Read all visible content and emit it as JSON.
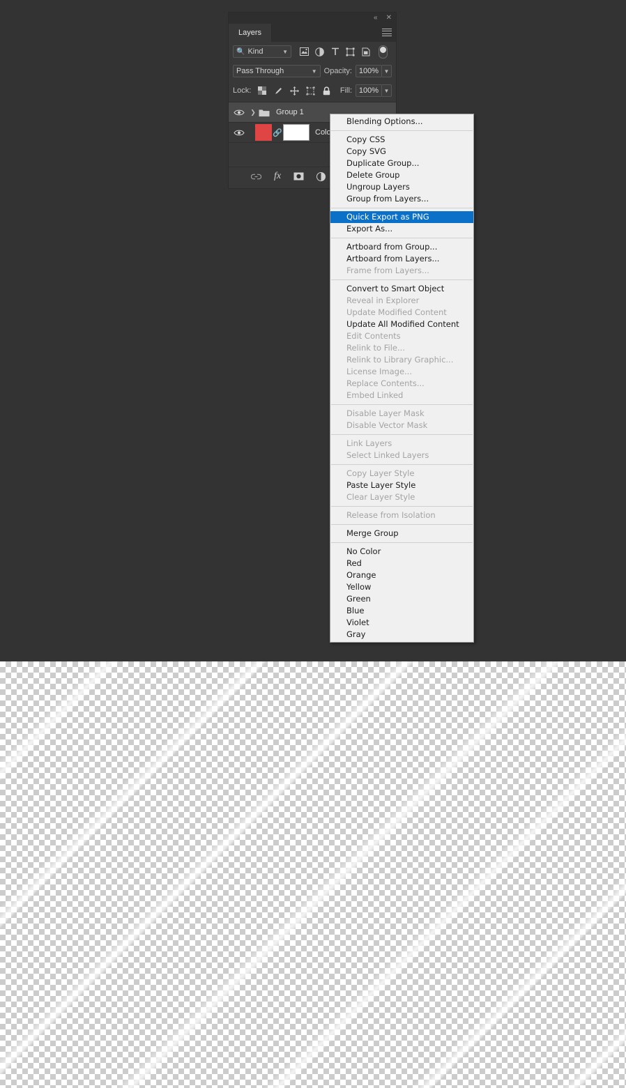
{
  "panel": {
    "title": "Layers",
    "titlebar": {
      "collapse_icon": "double-chevron-left",
      "close_icon": "close-x"
    },
    "filter": {
      "kind_label": "Kind",
      "search_icon": "magnifier-icon",
      "icons": [
        "pixel-layer-filter",
        "adjustment-layer-filter",
        "type-layer-filter",
        "shape-layer-filter",
        "smart-object-filter"
      ],
      "toggle_name": "filter-enable-toggle"
    },
    "blend": {
      "mode": "Pass Through",
      "opacity_label": "Opacity:",
      "opacity_value": "100%"
    },
    "lock": {
      "label": "Lock:",
      "fill_label": "Fill:",
      "fill_value": "100%",
      "icons": [
        "lock-transparent-pixels",
        "lock-image-pixels",
        "lock-position",
        "lock-artboard-nesting",
        "lock-all"
      ]
    },
    "layers": [
      {
        "name": "Group 1",
        "type": "group",
        "visible": true,
        "selected": true,
        "eye_icon": "eye-icon",
        "disclosure_icon": "chevron-right-icon",
        "folder_icon": "folder-icon"
      },
      {
        "name": "Colo",
        "type": "solid-color-fill",
        "visible": true,
        "selected": false,
        "eye_icon": "eye-icon",
        "swatch_color": "#e04545",
        "link_icon": "mask-link-icon",
        "mask_color": "#ffffff"
      }
    ],
    "footer_icons": [
      "link-layers-icon",
      "add-layer-style-fx-icon",
      "add-layer-mask-icon",
      "new-adjustment-layer-icon",
      "new-group-icon"
    ]
  },
  "context_menu": {
    "groups": [
      {
        "items": [
          {
            "label": "Blending Options...",
            "state": "enabled"
          }
        ]
      },
      {
        "items": [
          {
            "label": "Copy CSS",
            "state": "enabled"
          },
          {
            "label": "Copy SVG",
            "state": "enabled"
          },
          {
            "label": "Duplicate Group...",
            "state": "enabled"
          },
          {
            "label": "Delete Group",
            "state": "enabled"
          },
          {
            "label": "Ungroup Layers",
            "state": "enabled"
          },
          {
            "label": "Group from Layers...",
            "state": "enabled"
          }
        ]
      },
      {
        "items": [
          {
            "label": "Quick Export as PNG",
            "state": "selected"
          },
          {
            "label": "Export As...",
            "state": "enabled"
          }
        ]
      },
      {
        "items": [
          {
            "label": "Artboard from Group...",
            "state": "enabled"
          },
          {
            "label": "Artboard from Layers...",
            "state": "enabled"
          },
          {
            "label": "Frame from Layers...",
            "state": "disabled"
          }
        ]
      },
      {
        "items": [
          {
            "label": "Convert to Smart Object",
            "state": "enabled"
          },
          {
            "label": "Reveal in Explorer",
            "state": "disabled"
          },
          {
            "label": "Update Modified Content",
            "state": "disabled"
          },
          {
            "label": "Update All Modified Content",
            "state": "enabled"
          },
          {
            "label": "Edit Contents",
            "state": "disabled"
          },
          {
            "label": "Relink to File...",
            "state": "disabled"
          },
          {
            "label": "Relink to Library Graphic...",
            "state": "disabled"
          },
          {
            "label": "License Image...",
            "state": "disabled"
          },
          {
            "label": "Replace Contents...",
            "state": "disabled"
          },
          {
            "label": "Embed Linked",
            "state": "disabled"
          }
        ]
      },
      {
        "items": [
          {
            "label": "Disable Layer Mask",
            "state": "disabled"
          },
          {
            "label": "Disable Vector Mask",
            "state": "disabled"
          }
        ]
      },
      {
        "items": [
          {
            "label": "Link Layers",
            "state": "disabled"
          },
          {
            "label": "Select Linked Layers",
            "state": "disabled"
          }
        ]
      },
      {
        "items": [
          {
            "label": "Copy Layer Style",
            "state": "disabled"
          },
          {
            "label": "Paste Layer Style",
            "state": "enabled"
          },
          {
            "label": "Clear Layer Style",
            "state": "disabled"
          }
        ]
      },
      {
        "items": [
          {
            "label": "Release from Isolation",
            "state": "disabled"
          }
        ]
      },
      {
        "items": [
          {
            "label": "Merge Group",
            "state": "enabled"
          }
        ]
      },
      {
        "items": [
          {
            "label": "No Color",
            "state": "enabled"
          },
          {
            "label": "Red",
            "state": "enabled"
          },
          {
            "label": "Orange",
            "state": "enabled"
          },
          {
            "label": "Yellow",
            "state": "enabled"
          },
          {
            "label": "Green",
            "state": "enabled"
          },
          {
            "label": "Blue",
            "state": "enabled"
          },
          {
            "label": "Violet",
            "state": "enabled"
          },
          {
            "label": "Gray",
            "state": "enabled"
          }
        ]
      }
    ]
  },
  "colors": {
    "panel_bg": "#383838",
    "panel_header_bg": "#2e2e2e",
    "backdrop": "#333333",
    "menu_bg": "#f0f0f0",
    "menu_highlight": "#0a70c8",
    "menu_disabled_text": "#a3a3a3",
    "checker_light": "#ffffff",
    "checker_dark": "#cccccc",
    "layer_swatch_red": "#e04545"
  }
}
